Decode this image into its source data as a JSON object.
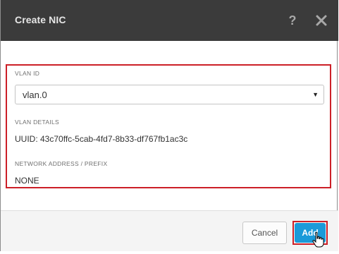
{
  "dialog": {
    "title": "Create NIC",
    "help_icon": "question-mark-icon",
    "close_icon": "close-x-icon"
  },
  "form": {
    "vlan_id_label": "VLAN ID",
    "vlan_id_value": "vlan.0",
    "vlan_details_label": "VLAN DETAILS",
    "vlan_details_value": "UUID: 43c70ffc-5cab-4fd7-8b33-df767fb1ac3c",
    "network_label": "NETWORK ADDRESS / PREFIX",
    "network_value": "NONE"
  },
  "footer": {
    "cancel_label": "Cancel",
    "add_label": "Add"
  },
  "colors": {
    "header_bg": "#3b3b3b",
    "highlight": "#cc1f27",
    "primary_button": "#1a9ad9"
  }
}
